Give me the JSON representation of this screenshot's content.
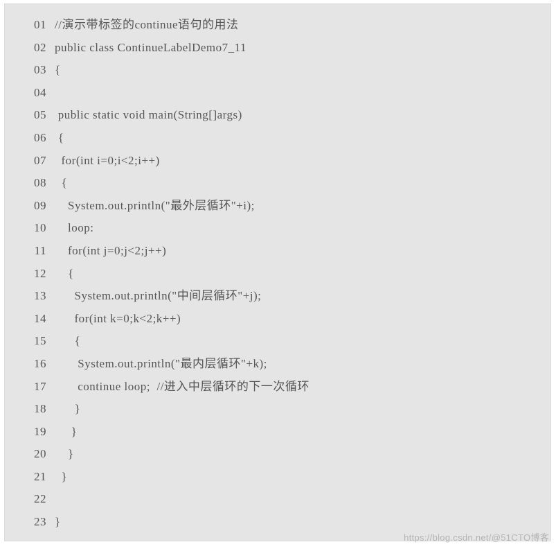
{
  "watermark": "https://blog.csdn.net/@51CTO博客",
  "code": {
    "lines": [
      {
        "num": "01",
        "text": "//演示带标签的continue语句的用法"
      },
      {
        "num": "02",
        "text": "public class ContinueLabelDemo7_11"
      },
      {
        "num": "03",
        "text": "{"
      },
      {
        "num": "04",
        "text": ""
      },
      {
        "num": "05",
        "text": " public static void main(String[]args)"
      },
      {
        "num": "06",
        "text": " {"
      },
      {
        "num": "07",
        "text": "  for(int i=0;i<2;i++)"
      },
      {
        "num": "08",
        "text": "  {"
      },
      {
        "num": "09",
        "text": "    System.out.println(\"最外层循环\"+i);"
      },
      {
        "num": "10",
        "text": "    loop:"
      },
      {
        "num": "11",
        "text": "    for(int j=0;j<2;j++)"
      },
      {
        "num": "12",
        "text": "    {"
      },
      {
        "num": "13",
        "text": "      System.out.println(\"中间层循环\"+j);"
      },
      {
        "num": "14",
        "text": "      for(int k=0;k<2;k++)"
      },
      {
        "num": "15",
        "text": "      {"
      },
      {
        "num": "16",
        "text": "       System.out.println(\"最内层循环\"+k);"
      },
      {
        "num": "17",
        "text": "       continue loop;  //进入中层循环的下一次循环"
      },
      {
        "num": "18",
        "text": "      }"
      },
      {
        "num": "19",
        "text": "     }"
      },
      {
        "num": "20",
        "text": "    }"
      },
      {
        "num": "21",
        "text": "  }"
      },
      {
        "num": "22",
        "text": ""
      },
      {
        "num": "23",
        "text": "}"
      }
    ]
  }
}
